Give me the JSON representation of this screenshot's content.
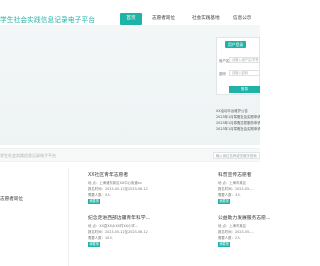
{
  "header": {
    "title": "学生社会实践信息记录电子平台",
    "nav": [
      "首页",
      "志愿者岗位",
      "社会实践基地",
      "信息公示"
    ]
  },
  "login": {
    "tab_label": "用户登录",
    "username_label": "用户名",
    "username_placeholder": "请输入用户名/学号",
    "password_label": "密码",
    "password_placeholder": "请输入密码",
    "submit_label": "登录"
  },
  "notices": [
    "XX活动平台维护公告",
    "2023年1月寒假社会实践申请",
    "2023年1月寒假志愿服务申请",
    "2023年1月寒假社会实践申请"
  ],
  "search": {
    "left_placeholder": "学生社会实践信息记录电子平台",
    "right_placeholder": "输入岗位名称或关键字查询"
  },
  "section": {
    "label": "志愿者岗位"
  },
  "cards": [
    {
      "title": "XX社区青年志愿者",
      "lines": [
        "地    点：上海浦东新区XX中心街道xx",
        "报名时间：2023-05-12至2023-06-12",
        "需要人数：5人"
      ],
      "button": "我要报名"
    },
    {
      "title": "科普宣传志愿者",
      "lines": [
        "地    点：上海市某区",
        "报名时间：2023-05-...",
        "需要人数：3人"
      ],
      "button": "我要报名"
    },
    {
      "title": "纪念走进西部边疆青年科学...",
      "lines": [
        "地    点：XX县XX乡XX村XX小学...",
        "报名时间：2023-05-12至2023-06-12",
        "需要人数：10人"
      ],
      "button": "我要报名"
    },
    {
      "title": "公益助力发展服务志愿...",
      "lines": [
        "地    点：上海市某区",
        "报名时间：2023-05-...",
        "需要人数：2人"
      ],
      "button": "我要报名"
    }
  ]
}
